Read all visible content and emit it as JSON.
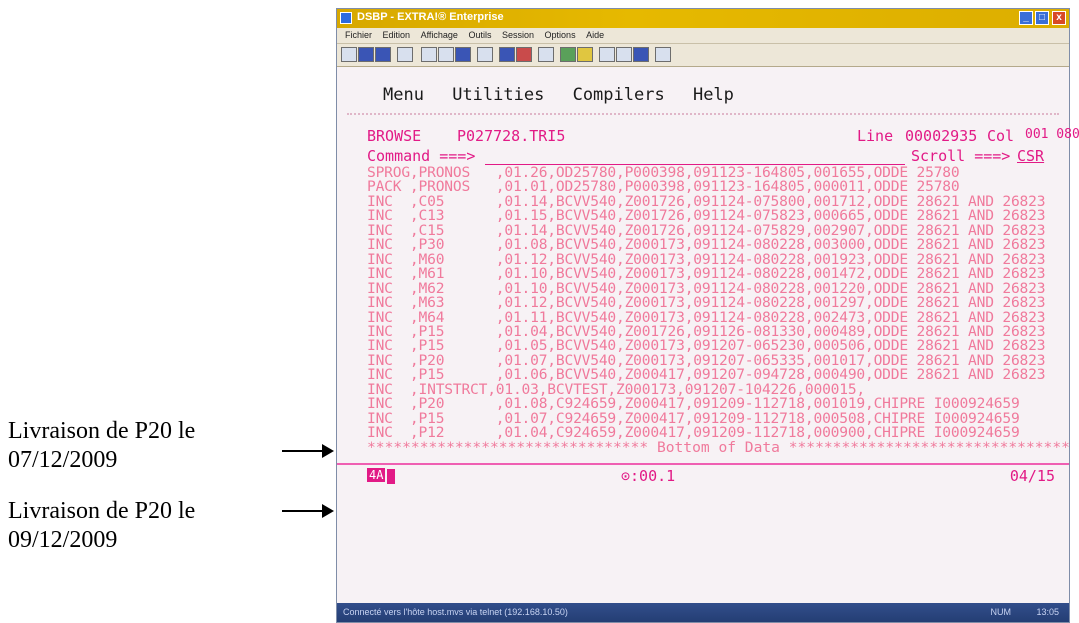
{
  "window": {
    "title": "DSBP - EXTRA!® Enterprise",
    "controls": {
      "minimize": "_",
      "maximize": "□",
      "close": "x"
    }
  },
  "menubar": [
    "Fichier",
    "Edition",
    "Affichage",
    "Outils",
    "Session",
    "Options",
    "Aide"
  ],
  "ispf_menu": [
    "Menu",
    "Utilities",
    "Compilers",
    "Help"
  ],
  "browse": {
    "mode": "BROWSE",
    "dataset": "P027728.TRI5",
    "line_label": "Line",
    "line_value": "00002935",
    "col_label": "Col",
    "col_value": "001 080",
    "command_label": "Command ===>",
    "scroll_label": "Scroll ===>",
    "scroll_value": "CSR"
  },
  "rows": [
    "SPROG,PRONOS   ,01.26,OD25780,P000398,091123-164805,001655,ODDE 25780",
    "PACK ,PRONOS   ,01.01,OD25780,P000398,091123-164805,000011,ODDE 25780",
    "INC  ,C05      ,01.14,BCVV540,Z001726,091124-075800,001712,ODDE 28621 AND 26823",
    "INC  ,C13      ,01.15,BCVV540,Z001726,091124-075823,000665,ODDE 28621 AND 26823",
    "INC  ,C15      ,01.14,BCVV540,Z001726,091124-075829,002907,ODDE 28621 AND 26823",
    "INC  ,P30      ,01.08,BCVV540,Z000173,091124-080228,003000,ODDE 28621 AND 26823",
    "INC  ,M60      ,01.12,BCVV540,Z000173,091124-080228,001923,ODDE 28621 AND 26823",
    "INC  ,M61      ,01.10,BCVV540,Z000173,091124-080228,001472,ODDE 28621 AND 26823",
    "INC  ,M62      ,01.10,BCVV540,Z000173,091124-080228,001220,ODDE 28621 AND 26823",
    "INC  ,M63      ,01.12,BCVV540,Z000173,091124-080228,001297,ODDE 28621 AND 26823",
    "INC  ,M64      ,01.11,BCVV540,Z000173,091124-080228,002473,ODDE 28621 AND 26823",
    "INC  ,P15      ,01.04,BCVV540,Z001726,091126-081330,000489,ODDE 28621 AND 26823",
    "INC  ,P15      ,01.05,BCVV540,Z000173,091207-065230,000506,ODDE 28621 AND 26823",
    "INC  ,P20      ,01.07,BCVV540,Z000173,091207-065335,001017,ODDE 28621 AND 26823",
    "INC  ,P15      ,01.06,BCVV540,Z000417,091207-094728,000490,ODDE 28621 AND 26823",
    "INC  ,INTSTRCT,01.03,BCVTEST,Z000173,091207-104226,000015,",
    "INC  ,P20      ,01.08,C924659,Z000417,091209-112718,001019,CHIPRE I000924659",
    "INC  ,P15      ,01.07,C924659,Z000417,091209-112718,000508,CHIPRE I000924659",
    "INC  ,P12      ,01.04,C924659,Z000417,091209-112718,000900,CHIPRE I000924659"
  ],
  "bottom_of_data": "******************************** Bottom of Data ********************************",
  "oia": {
    "session": "4A",
    "timer": "⊙:00.1",
    "cursor_pos": "04/15"
  },
  "statusbar": {
    "left": "Connecté vers l'hôte host.mvs via telnet (192.168.10.50)",
    "num": "NUM",
    "time": "13:05"
  },
  "annotations": [
    {
      "line1": "Livraison de P20 le",
      "line2": "07/12/2009"
    },
    {
      "line1": "Livraison de P20 le",
      "line2": "09/12/2009"
    }
  ]
}
